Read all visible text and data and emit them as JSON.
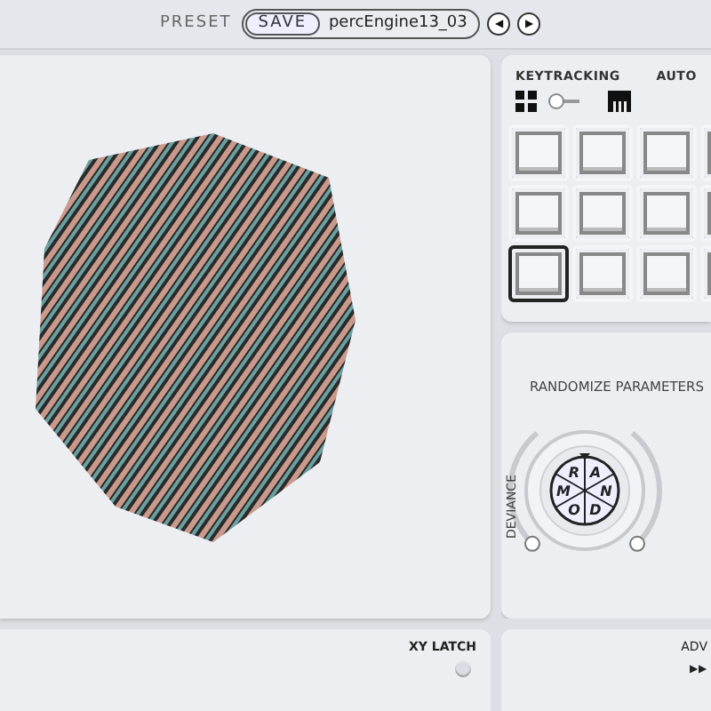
{
  "preset_bar": {
    "label": "PRESET",
    "save_button": "SAVE",
    "preset_name": "percEngine13_03",
    "prev_symbol": "◀",
    "next_symbol": "▶"
  },
  "side_panel": {
    "keytracking_label": "KEYTRACKING",
    "auto_label": "AUTO",
    "keytracking_switch_on": false,
    "pads": [
      {
        "selected": false
      },
      {
        "selected": false
      },
      {
        "selected": false
      },
      {
        "selected": false
      },
      {
        "selected": false
      },
      {
        "selected": false
      },
      {
        "selected": false
      },
      {
        "selected": false
      },
      {
        "selected": true
      },
      {
        "selected": false
      },
      {
        "selected": false
      },
      {
        "selected": false
      }
    ]
  },
  "randomize": {
    "title": "RANDOMIZE PARAMETERS",
    "dial_letters": [
      "R",
      "A",
      "M",
      "N",
      "O",
      "D"
    ],
    "deviance": {
      "label": "DEVIANCE",
      "level": 0.05
    },
    "right_slider": {
      "level": 0.05
    }
  },
  "bottom": {
    "xy_latch_label": "XY LATCH",
    "xy_latch_on": false,
    "adv_label": "ADV",
    "adv_symbol": "▶▶"
  }
}
